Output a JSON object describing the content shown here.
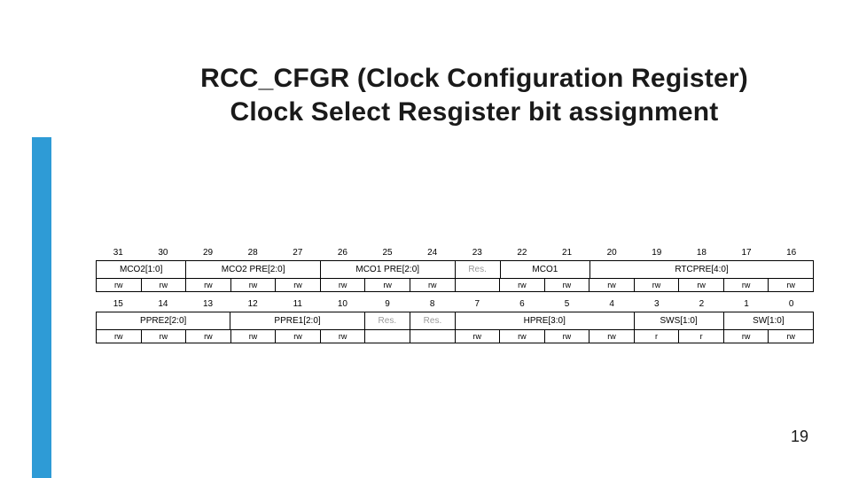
{
  "title_line1": "RCC_CFGR (Clock Configuration Register)",
  "title_line2": "Clock Select Resgister bit assignment",
  "page_number": "19",
  "bits_high": [
    "31",
    "30",
    "29",
    "28",
    "27",
    "26",
    "25",
    "24",
    "23",
    "22",
    "21",
    "20",
    "19",
    "18",
    "17",
    "16"
  ],
  "bits_low": [
    "15",
    "14",
    "13",
    "12",
    "11",
    "10",
    "9",
    "8",
    "7",
    "6",
    "5",
    "4",
    "3",
    "2",
    "1",
    "0"
  ],
  "fields_high": [
    {
      "label": "MCO2[1:0]",
      "span": 2
    },
    {
      "label": "MCO2 PRE[2:0]",
      "span": 3
    },
    {
      "label": "MCO1 PRE[2:0]",
      "span": 3
    },
    {
      "label": "Res.",
      "span": 1,
      "reserved": true
    },
    {
      "label": "MCO1",
      "span": 2
    },
    {
      "label": "RTCPRE[4:0]",
      "span": 5
    }
  ],
  "rw_high": [
    "rw",
    "rw",
    "rw",
    "rw",
    "rw",
    "rw",
    "rw",
    "rw",
    "",
    "rw",
    "rw",
    "rw",
    "rw",
    "rw",
    "rw",
    "rw"
  ],
  "fields_low": [
    {
      "label": "PPRE2[2:0]",
      "span": 3
    },
    {
      "label": "PPRE1[2:0]",
      "span": 3
    },
    {
      "label": "Res.",
      "span": 1,
      "reserved": true
    },
    {
      "label": "Res.",
      "span": 1,
      "reserved": true
    },
    {
      "label": "HPRE[3:0]",
      "span": 4
    },
    {
      "label": "SWS[1:0]",
      "span": 2
    },
    {
      "label": "SW[1:0]",
      "span": 2
    }
  ],
  "rw_low": [
    "rw",
    "rw",
    "rw",
    "rw",
    "rw",
    "rw",
    "",
    "",
    "rw",
    "rw",
    "rw",
    "rw",
    "r",
    "r",
    "rw",
    "rw"
  ]
}
